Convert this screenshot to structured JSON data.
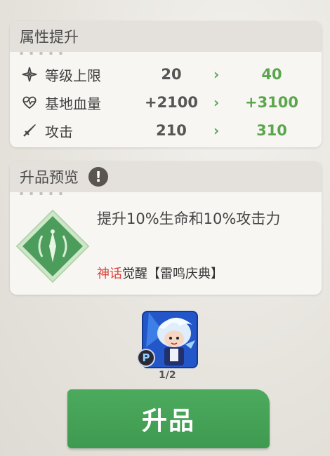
{
  "attributes": {
    "title": "属性提升",
    "dots": "▪ ▪ ▪ ▪ ▪",
    "rows": [
      {
        "icon": "star-sparkle-icon",
        "label": "等级上限",
        "old": "20",
        "arrow": "›",
        "new": "40"
      },
      {
        "icon": "heart-icon",
        "label": "基地血量",
        "old": "+2100",
        "arrow": "›",
        "new": "+3100"
      },
      {
        "icon": "sword-icon",
        "label": "攻击",
        "old": "210",
        "arrow": "›",
        "new": "310"
      }
    ]
  },
  "preview": {
    "title": "升品预览",
    "warn_symbol": "!",
    "dots": "▪ ▪ ▪ ▪ ▪",
    "description": "提升10%生命和10%攻击力",
    "awaken_myth": "神话",
    "awaken_rest": "觉醒【雷鸣庆典】"
  },
  "material": {
    "badge": "P",
    "count": "1/2"
  },
  "upgrade_button": "升品",
  "colors": {
    "accent_green": "#5ba64c",
    "myth_red": "#e0403a",
    "button_green": "#46a258"
  }
}
